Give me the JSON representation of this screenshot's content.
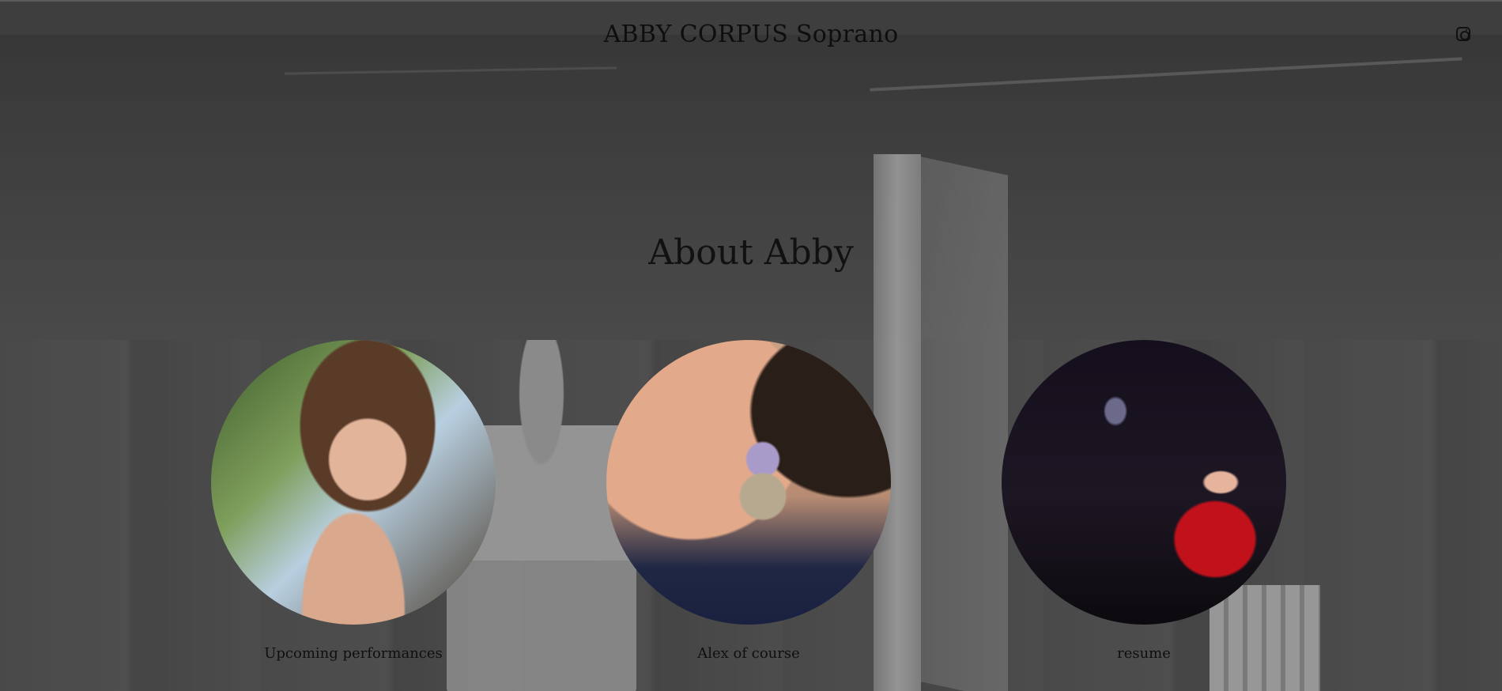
{
  "header": {
    "site_title": "ABBY CORPUS Soprano",
    "social_icon": "instagram-icon"
  },
  "main": {
    "heading": "About Abby",
    "cards": [
      {
        "caption": "Upcoming performances",
        "image": "portrait-photo"
      },
      {
        "caption": "Alex of course",
        "image": "lizard-photo"
      },
      {
        "caption": "resume",
        "image": "performance-photo"
      }
    ]
  },
  "colors": {
    "text": "#111111",
    "header_bg": "#464646"
  }
}
